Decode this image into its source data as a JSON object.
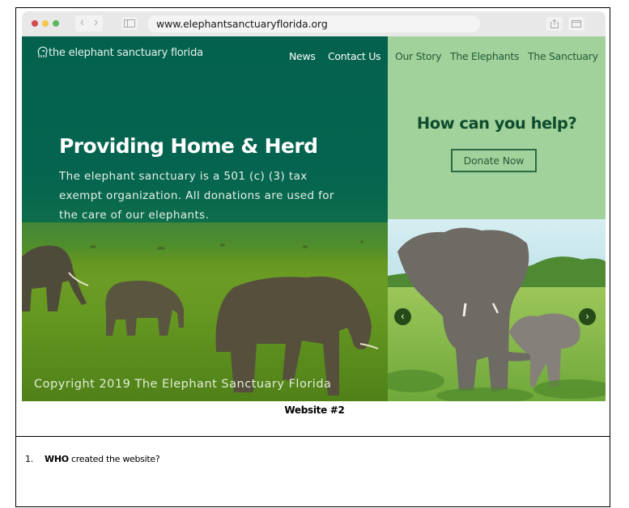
{
  "browser": {
    "url": "www.elephantsanctuaryflorida.org",
    "back_icon": "chevron-left-icon",
    "forward_icon": "chevron-right-icon",
    "back_glyph": "‹",
    "forward_glyph": "›"
  },
  "site": {
    "logo_text": "the elephant sanctuary florida",
    "nav_primary": [
      {
        "label": "News"
      },
      {
        "label": "Contact Us"
      }
    ],
    "nav_secondary": [
      {
        "label": "Our Story"
      },
      {
        "label": "The Elephants"
      },
      {
        "label": "The Sanctuary"
      }
    ],
    "hero": {
      "title": "Providing Home & Herd",
      "text": "The elephant sanctuary is a 501 (c) (3) tax exempt organization. All donations are used for the care of our elephants."
    },
    "help": {
      "title": "How can you help?",
      "donate_label": "Donate Now"
    },
    "carousel": {
      "prev_glyph": "‹",
      "next_glyph": "›"
    },
    "copyright": "Copyright 2019 The Elephant Sanctuary Florida",
    "colors": {
      "dark_green": "#03614e",
      "light_green": "#a2d29b",
      "help_title": "#0f4c2e"
    }
  },
  "document": {
    "caption": "Website #2",
    "question": {
      "number": "1.",
      "emphasis": "WHO",
      "text": " created the website?"
    }
  }
}
